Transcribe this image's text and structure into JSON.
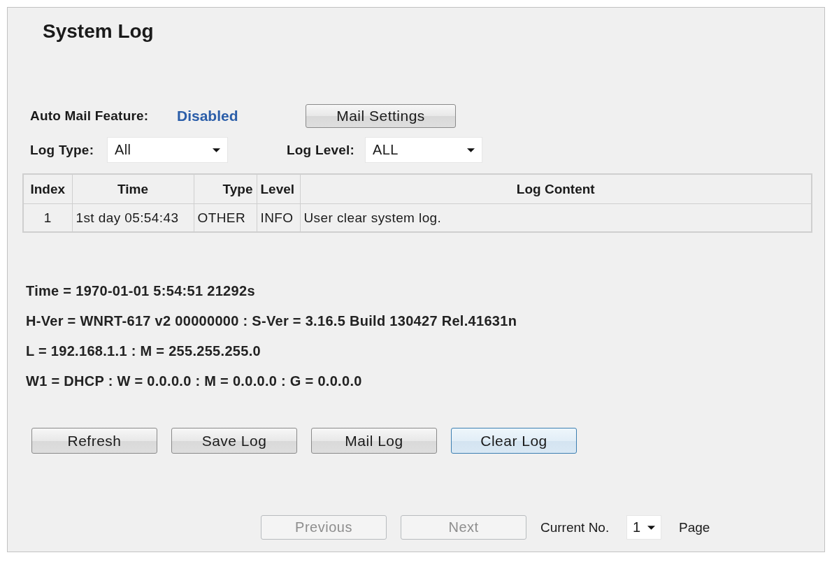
{
  "title": "System Log",
  "auto_mail": {
    "label": "Auto Mail Feature:",
    "status": "Disabled",
    "button": "Mail Settings"
  },
  "filters": [
    {
      "label": "Log Type:",
      "value": "All"
    },
    {
      "label": "Log Level:",
      "value": "ALL"
    }
  ],
  "table": {
    "columns": [
      "Index",
      "Time",
      "Type",
      "Level",
      "Log Content"
    ],
    "rows": [
      [
        "1",
        "1st day 05:54:43",
        "OTHER",
        "INFO",
        "User clear system log."
      ]
    ]
  },
  "info_lines": [
    "Time = 1970-01-01 5:54:51 21292s",
    "H-Ver = WNRT-617 v2 00000000 : S-Ver = 3.16.5 Build 130427 Rel.41631n",
    "L = 192.168.1.1 : M = 255.255.255.0",
    "W1 = DHCP : W = 0.0.0.0 : M = 0.0.0.0 : G = 0.0.0.0"
  ],
  "buttons": [
    {
      "label": "Refresh",
      "focused": false
    },
    {
      "label": "Save Log",
      "focused": false
    },
    {
      "label": "Mail Log",
      "focused": false
    },
    {
      "label": "Clear Log",
      "focused": true
    }
  ],
  "pagination": {
    "previous": {
      "label": "Previous",
      "disabled": true
    },
    "next": {
      "label": "Next",
      "disabled": true
    },
    "current_label": "Current No.",
    "page_value": "1",
    "page_label": "Page"
  }
}
